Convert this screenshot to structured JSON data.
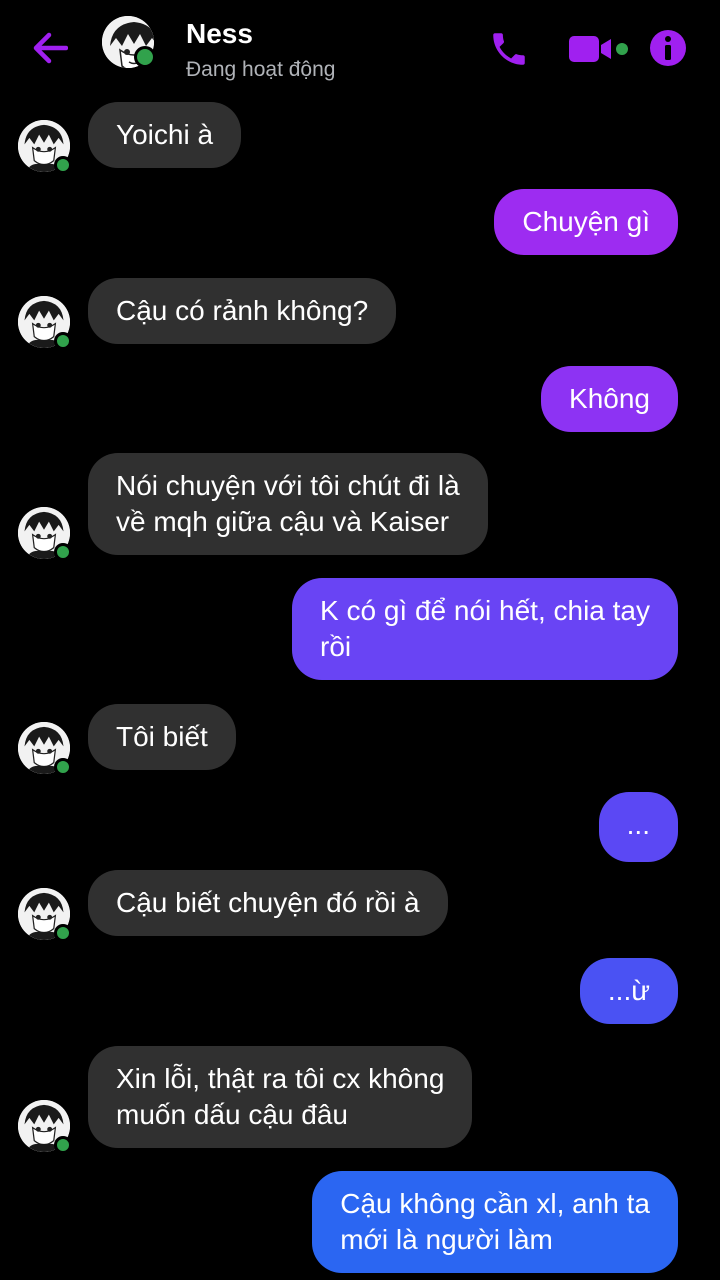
{
  "header": {
    "name": "Ness",
    "status": "Đang hoạt động",
    "back_icon": "arrow-left-icon",
    "call_icon": "phone-icon",
    "video_icon": "video-camera-icon",
    "info_icon": "info-icon"
  },
  "colors": {
    "accent": "#a020f0",
    "incoming": "#303030",
    "outgoing_top": "#9d2cf1",
    "outgoing_bottom": "#1877f2",
    "online": "#31a24c"
  },
  "messages": [
    {
      "dir": "in",
      "text": "Yoichi à"
    },
    {
      "dir": "out",
      "text": "Chuyện gì"
    },
    {
      "dir": "in",
      "text": "Cậu có rảnh không?"
    },
    {
      "dir": "out",
      "text": "Không"
    },
    {
      "dir": "in",
      "text": "Nói chuyện với tôi chút đi là\nvề mqh giữa cậu và Kaiser"
    },
    {
      "dir": "out",
      "text": "K có gì để nói hết, chia tay\nrồi"
    },
    {
      "dir": "in",
      "text": "Tôi biết"
    },
    {
      "dir": "out",
      "text": "..."
    },
    {
      "dir": "in",
      "text": "Cậu biết chuyện đó rồi à"
    },
    {
      "dir": "out",
      "text": "...ừ"
    },
    {
      "dir": "in",
      "text": "Xin lỗi, thật ra tôi cx không\nmuốn dấu cậu đâu"
    },
    {
      "dir": "out",
      "text": "Cậu không cần xl, anh ta\nmới là người làm"
    }
  ]
}
